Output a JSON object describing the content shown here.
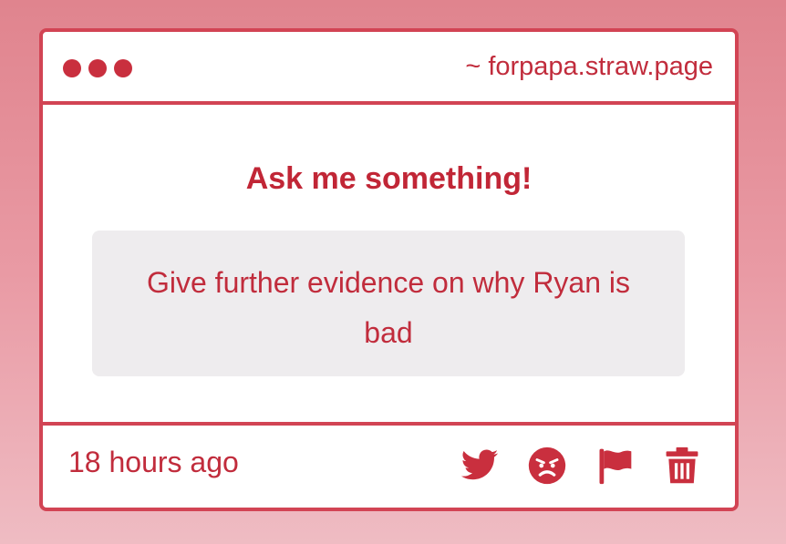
{
  "window": {
    "url": "~ forpapa.straw.page"
  },
  "main": {
    "heading": "Ask me something!",
    "question": "Give further evidence on why Ryan is bad"
  },
  "footer": {
    "timestamp": "18 hours ago",
    "icons": [
      "twitter-icon",
      "angry-face-icon",
      "flag-icon",
      "trash-icon"
    ]
  },
  "colors": {
    "accent": "#d24454",
    "text": "#c12c3c",
    "question_bg": "#eeecee"
  }
}
